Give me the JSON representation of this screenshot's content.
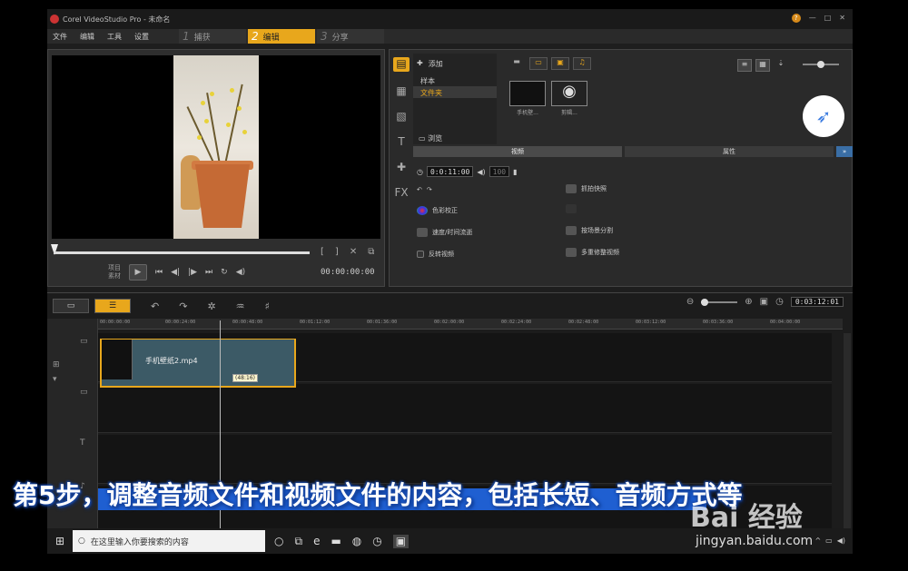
{
  "app": {
    "title": "Corel VideoStudio Pro - 未命名",
    "menu": [
      "文件",
      "编辑",
      "工具",
      "设置"
    ],
    "steps": [
      {
        "num": "1",
        "label": "捕获"
      },
      {
        "num": "2",
        "label": "编辑"
      },
      {
        "num": "3",
        "label": "分享"
      }
    ],
    "active_step": 1
  },
  "preview": {
    "mode_label_1": "项目",
    "mode_label_2": "素材",
    "timecode": "00:00:00:00"
  },
  "library": {
    "add_label": "添加",
    "items": [
      "样本",
      "文件夹"
    ],
    "selected_item": "文件夹",
    "browse_label": "浏览",
    "thumbs": [
      {
        "caption": "手机壁..."
      },
      {
        "caption": "剪辑..."
      }
    ],
    "tabs": [
      "视频",
      "属性"
    ],
    "duration": "0:0:11:00",
    "volume": "100",
    "options_left": [
      "色彩校正",
      "速度/时间流逝",
      "反转视频"
    ],
    "options_right": [
      "抓拍快照",
      "按场景分割",
      "多重修整视频"
    ]
  },
  "timeline": {
    "timecode": "0:03:12:01",
    "ruler": [
      "00:00:00:00",
      "00:00:24:00",
      "00:00:48:00",
      "00:01:12:00",
      "00:01:36:00",
      "00:02:00:00",
      "00:02:24:00",
      "00:02:48:00",
      "00:03:12:00",
      "00:03:36:00",
      "00:04:00:00"
    ],
    "clip_name": "手机壁纸2.mp4",
    "clip_duration": "(48:16)"
  },
  "taskbar": {
    "search_placeholder": "在这里输入你要搜索的内容"
  },
  "overlay": {
    "subtitle": "第5步，调整音频文件和视频文件的内容，包括长短、音频方式等",
    "watermark": "Bai 经验",
    "watermark_url": "jingyan.baidu.com"
  }
}
